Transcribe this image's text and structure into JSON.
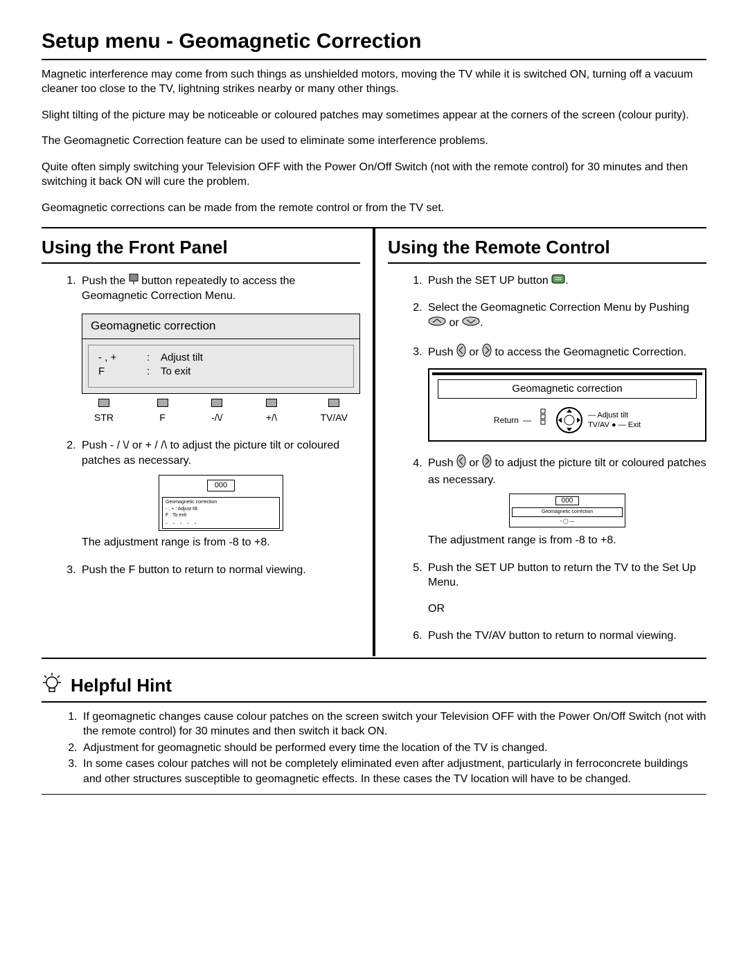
{
  "title": "Setup menu - Geomagnetic Correction",
  "intro": {
    "p1": "Magnetic interference may come from such things as unshielded motors, moving the TV while it is switched ON, turning off a vacuum cleaner too close to the TV, lightning strikes nearby or many other things.",
    "p2": "Slight tilting of the picture may be noticeable or coloured patches may sometimes appear at the corners of the screen (colour purity).",
    "p3": "The Geomagnetic Correction feature can be used to eliminate some interference problems.",
    "p4": "Quite often simply switching your Television OFF with the Power On/Off Switch (not with the remote control) for 30 minutes and then switching it back ON will cure the problem.",
    "p5": "Geomagnetic corrections can be made from the remote control or from the TV set."
  },
  "front": {
    "heading": "Using the Front Panel",
    "s1a": "Push the ",
    "s1b": " button repeatedly to access the Geomagnetic Correction Menu.",
    "screen_title": "Geomagnetic correction",
    "row1_left": "- , +",
    "row1_right": "Adjust tilt",
    "row2_left": "F",
    "row2_right": "To exit",
    "btn_str": "STR",
    "btn_f": "F",
    "btn_minus": "-/\\/",
    "btn_plus": "+/\\",
    "btn_tvav": "TV/AV",
    "s2": "Push - / \\/ or + / /\\ to adjust the picture tilt or coloured patches as necessary.",
    "mini_val": "000",
    "mini_sub_title": "Geomagnetic correction",
    "mini_r1": "- , +     :   Adjust tilt",
    "mini_r2": "F         :   To exit",
    "range": "The adjustment range is from -8 to +8.",
    "s3": "Push the F button to return to normal viewing."
  },
  "remote": {
    "heading": "Using the Remote Control",
    "s1a": "Push the SET UP button ",
    "s1b": ".",
    "s2a": "Select the Geomagnetic Correction Menu by Pushing ",
    "s2b": " or ",
    "s2c": ".",
    "s3a": "Push ",
    "s3b": " or ",
    "s3c": " to access the Geomagnetic Correction.",
    "screen_title": "Geomagnetic correction",
    "label_return": "Return",
    "label_adjust": "Adjust tilt",
    "label_tvav": "TV/AV",
    "label_exit": "Exit",
    "s4a": "Push ",
    "s4b": " or ",
    "s4c": " to adjust the picture tilt or coloured patches as necessary.",
    "mini_val": "000",
    "mini_sub_title": "Geomagnetic correction",
    "range": "The adjustment range is from -8 to +8.",
    "s5": "Push the SET UP button to return the TV to the Set Up Menu.",
    "or": "OR",
    "s6": "Push the TV/AV button to return to normal viewing."
  },
  "hint": {
    "heading": "Helpful Hint",
    "h1": "If geomagnetic changes cause colour patches on the screen switch your Television OFF with the Power On/Off Switch (not with the remote control) for 30 minutes and then switch it back ON.",
    "h2": "Adjustment for geomagnetic should be performed every time the location of the TV is changed.",
    "h3": "In some cases colour patches will not be completely eliminated even after adjustment, particularly in ferroconcrete buildings and other structures susceptible to geomagnetic effects. In these cases the TV location will have to be changed."
  }
}
